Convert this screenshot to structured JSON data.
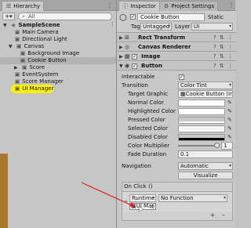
{
  "hierarchy": {
    "tab_label": "Hierarchy",
    "add_label": "+▾",
    "search_placeholder": "All",
    "scene": "SampleScene",
    "items": [
      {
        "label": "Main Camera"
      },
      {
        "label": "Directional Light"
      },
      {
        "label": "Canvas"
      },
      {
        "label": "Background Image"
      },
      {
        "label": "Cookie Button"
      },
      {
        "label": "Score"
      },
      {
        "label": "EventSystem"
      },
      {
        "label": "Score Manager"
      },
      {
        "label": "UI Manager"
      }
    ]
  },
  "inspector": {
    "tab_label": "Inspector",
    "tab2_label": "Project Settings",
    "object_name": "Cookie Button",
    "static_label": "Static",
    "tag_label": "Tag",
    "tag_value": "Untagged",
    "layer_label": "Layer",
    "layer_value": "UI",
    "components": {
      "rect_transform": "Rect Transform",
      "canvas_renderer": "Canvas Renderer",
      "image": "Image",
      "button": "Button"
    },
    "props": {
      "interactable": "Interactable",
      "transition": "Transition",
      "transition_value": "Color Tint",
      "target_graphic": "Target Graphic",
      "target_graphic_value": "Cookie Button (In",
      "normal": "Normal Color",
      "highlighted": "Highlighted Color",
      "pressed": "Pressed Color",
      "selected": "Selected Color",
      "disabled": "Disabled Color",
      "multiplier": "Color Multiplier",
      "multiplier_value": "1",
      "fade": "Fade Duration",
      "fade_value": "0.1",
      "navigation": "Navigation",
      "navigation_value": "Automatic",
      "visualize": "Visualize"
    },
    "onclick": {
      "title": "On Click ()",
      "runtime": "Runtime",
      "function": "No Function",
      "object": "UI Mar",
      "plus": "+",
      "minus": "–"
    }
  },
  "colors": {
    "highlight": "#fff200",
    "arrow": "#e02020"
  }
}
